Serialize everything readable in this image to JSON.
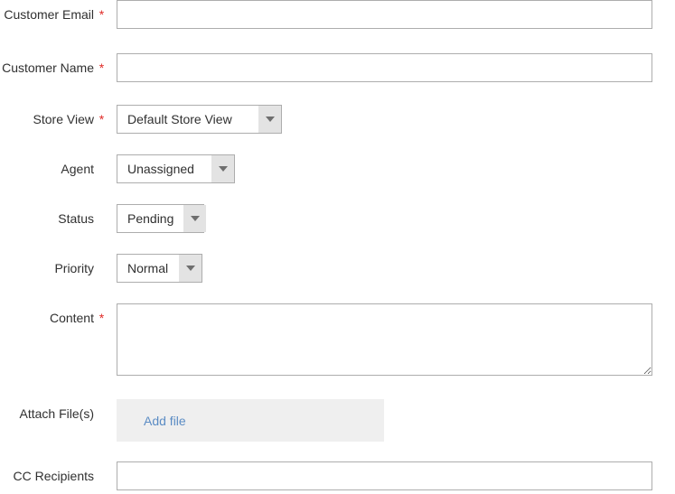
{
  "form": {
    "fields": [
      {
        "key": "customer_email",
        "label": "Customer Email",
        "required": true,
        "required_marker": "*",
        "type": "text",
        "value": "",
        "placeholder": ""
      },
      {
        "key": "customer_name",
        "label": "Customer Name",
        "required": true,
        "required_marker": "*",
        "type": "text",
        "value": "",
        "placeholder": ""
      },
      {
        "key": "store_view",
        "label": "Store View",
        "required": true,
        "required_marker": "*",
        "type": "select",
        "value": "Default Store View"
      },
      {
        "key": "agent",
        "label": "Agent",
        "required": false,
        "type": "select",
        "value": "Unassigned"
      },
      {
        "key": "status",
        "label": "Status",
        "required": false,
        "type": "select",
        "value": "Pending"
      },
      {
        "key": "priority",
        "label": "Priority",
        "required": false,
        "type": "select",
        "value": "Normal"
      },
      {
        "key": "content",
        "label": "Content",
        "required": true,
        "required_marker": "*",
        "type": "textarea",
        "value": "",
        "placeholder": ""
      },
      {
        "key": "attach_files",
        "label": "Attach File(s)",
        "required": false,
        "type": "file",
        "action_label": "Add file"
      },
      {
        "key": "cc_recipients",
        "label": "CC Recipients",
        "required": false,
        "type": "text",
        "value": "",
        "placeholder": ""
      }
    ]
  },
  "colors": {
    "required_asterisk": "#e02b27",
    "label_text": "#303030",
    "input_border": "#adadad",
    "select_arrow_bg": "#e3e3e3",
    "attach_box_bg": "#efefef",
    "link_blue": "#5b8cc4",
    "page_bg": "#ffffff"
  },
  "icons": {
    "dropdown_arrow": "chevron-down-icon"
  }
}
